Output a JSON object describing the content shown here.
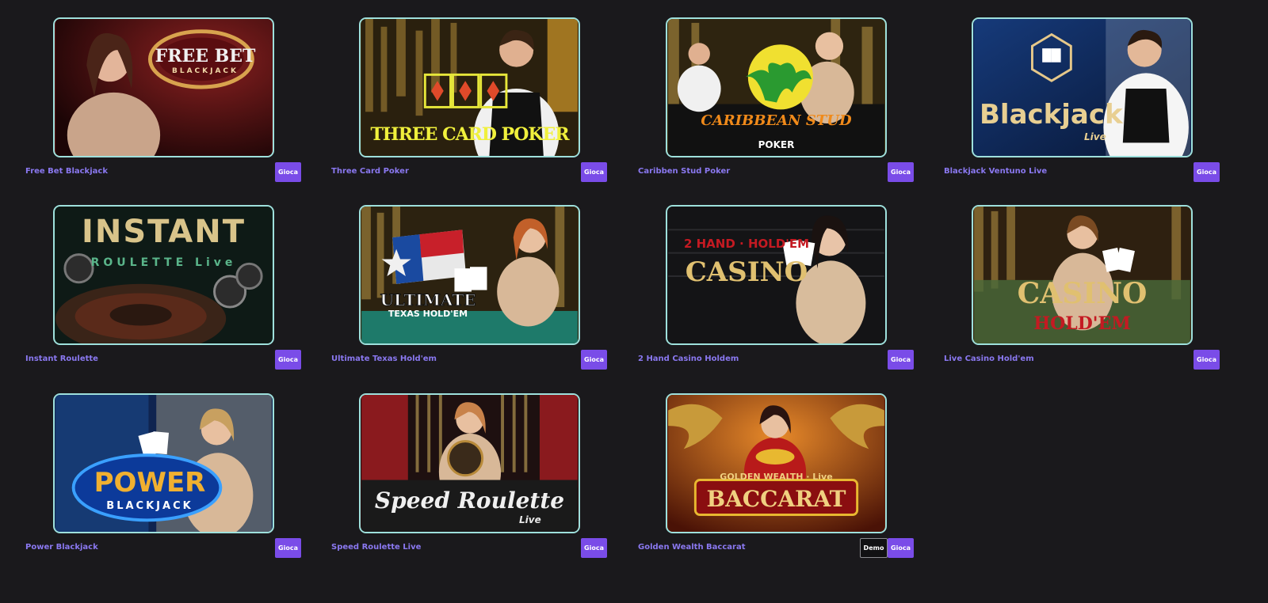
{
  "games": [
    {
      "title": "Free Bet Blackjack",
      "play": "Gioca",
      "logo": "FREE BET",
      "logo_sub": "BLACKJACK",
      "theme": "#5a1214"
    },
    {
      "title": "Three Card Poker",
      "play": "Gioca",
      "logo": "THREE CARD POKER",
      "logo_sub": "",
      "theme": "#3a2c12"
    },
    {
      "title": "Caribben Stud Poker",
      "play": "Gioca",
      "logo": "CARIBBEAN STUD",
      "logo_sub": "POKER",
      "theme": "#3b2f10"
    },
    {
      "title": "Blackjack Ventuno Live",
      "play": "Gioca",
      "logo": "Blackjack",
      "logo_sub": "Live",
      "theme": "#0e2350"
    },
    {
      "title": "Instant Roulette",
      "play": "Gioca",
      "logo": "INSTANT",
      "logo_sub": "ROULETTE Live",
      "theme": "#12221c"
    },
    {
      "title": "Ultimate Texas Hold'em",
      "play": "Gioca",
      "logo": "ULTIMATE",
      "logo_sub": "TEXAS HOLD'EM",
      "theme": "#3a2c12"
    },
    {
      "title": "2 Hand Casino Holdem",
      "play": "Gioca",
      "logo": "CASINO",
      "logo_sub": "2 HAND · HOLD'EM",
      "theme": "#151518"
    },
    {
      "title": "Live Casino Hold'em",
      "play": "Gioca",
      "logo": "CASINO",
      "logo_sub": "HOLD'EM",
      "theme": "#3a2812"
    },
    {
      "title": "Power Blackjack",
      "play": "Gioca",
      "logo": "POWER",
      "logo_sub": "BLACKJACK",
      "theme": "#142a55"
    },
    {
      "title": "Speed Roulette Live",
      "play": "Gioca",
      "logo": "Speed Roulette",
      "logo_sub": "Live",
      "theme": "#2a0e10"
    },
    {
      "title": "Golden Wealth Baccarat",
      "play": "Gioca",
      "demo": "Demo",
      "logo": "BACCARAT",
      "logo_sub": "GOLDEN WEALTH · Live",
      "theme": "#5a1a08"
    }
  ]
}
